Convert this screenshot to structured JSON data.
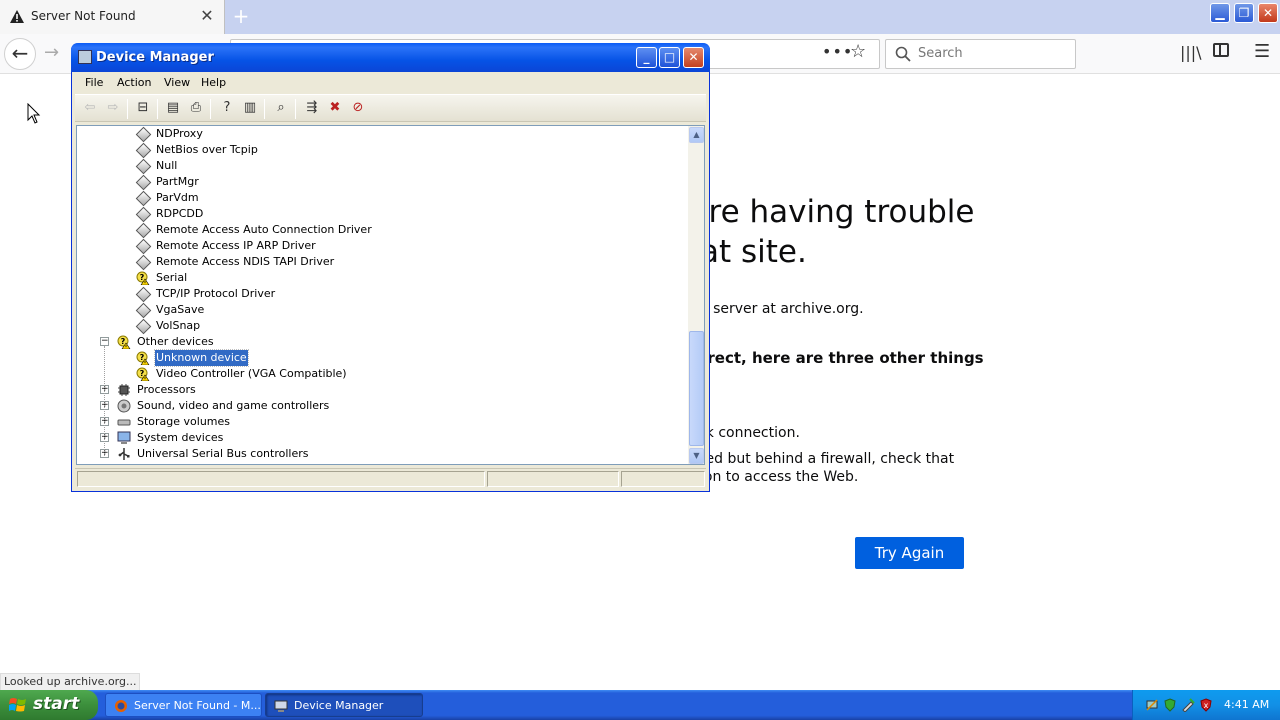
{
  "browser": {
    "tab_title": "Server Not Found",
    "tab_close": "✕",
    "new_tab": "+",
    "search_placeholder": "Search",
    "page_heading": "'re having trouble\nat site.",
    "server_line": "e server at archive.org.",
    "bold_line": "rrect, here are three other things",
    "network_line": "rk connection.",
    "firewall_line1": "ted but behind a firewall, check that",
    "firewall_line2": "ion to access the Web.",
    "try_again": "Try Again",
    "status": "Looked up archive.org..."
  },
  "device_manager": {
    "title": "Device Manager",
    "menu": [
      "File",
      "Action",
      "View",
      "Help"
    ],
    "tree": [
      {
        "label": "NDProxy",
        "icon": "driver-icon"
      },
      {
        "label": "NetBios over Tcpip",
        "icon": "driver-icon"
      },
      {
        "label": "Null",
        "icon": "driver-icon"
      },
      {
        "label": "PartMgr",
        "icon": "driver-icon"
      },
      {
        "label": "ParVdm",
        "icon": "driver-icon"
      },
      {
        "label": "RDPCDD",
        "icon": "driver-icon"
      },
      {
        "label": "Remote Access Auto Connection Driver",
        "icon": "driver-icon"
      },
      {
        "label": "Remote Access IP ARP Driver",
        "icon": "driver-icon"
      },
      {
        "label": "Remote Access NDIS TAPI Driver",
        "icon": "driver-icon"
      },
      {
        "label": "Serial",
        "icon": "warning-device-icon"
      },
      {
        "label": "TCP/IP Protocol Driver",
        "icon": "driver-icon"
      },
      {
        "label": "VgaSave",
        "icon": "driver-icon"
      },
      {
        "label": "VolSnap",
        "icon": "driver-icon"
      },
      {
        "label": "Other devices",
        "icon": "unknown-device-category-icon"
      },
      {
        "label": "Unknown device",
        "icon": "warning-device-icon",
        "selected": true
      },
      {
        "label": "Video Controller (VGA Compatible)",
        "icon": "warning-device-icon"
      },
      {
        "label": "Processors",
        "icon": "processor-icon"
      },
      {
        "label": "Sound, video and game controllers",
        "icon": "sound-icon"
      },
      {
        "label": "Storage volumes",
        "icon": "storage-icon"
      },
      {
        "label": "System devices",
        "icon": "system-device-icon"
      },
      {
        "label": "Universal Serial Bus controllers",
        "icon": "usb-icon"
      }
    ]
  },
  "taskbar": {
    "start": "start",
    "tasks": [
      "Server Not Found - M...",
      "Device Manager"
    ],
    "clock": "4:41 AM"
  },
  "colors": {
    "accent_blue": "#0060df",
    "xp_title_blue": "#0a5bf5",
    "selection": "#316ac5",
    "start_green": "#3c8f3c"
  }
}
